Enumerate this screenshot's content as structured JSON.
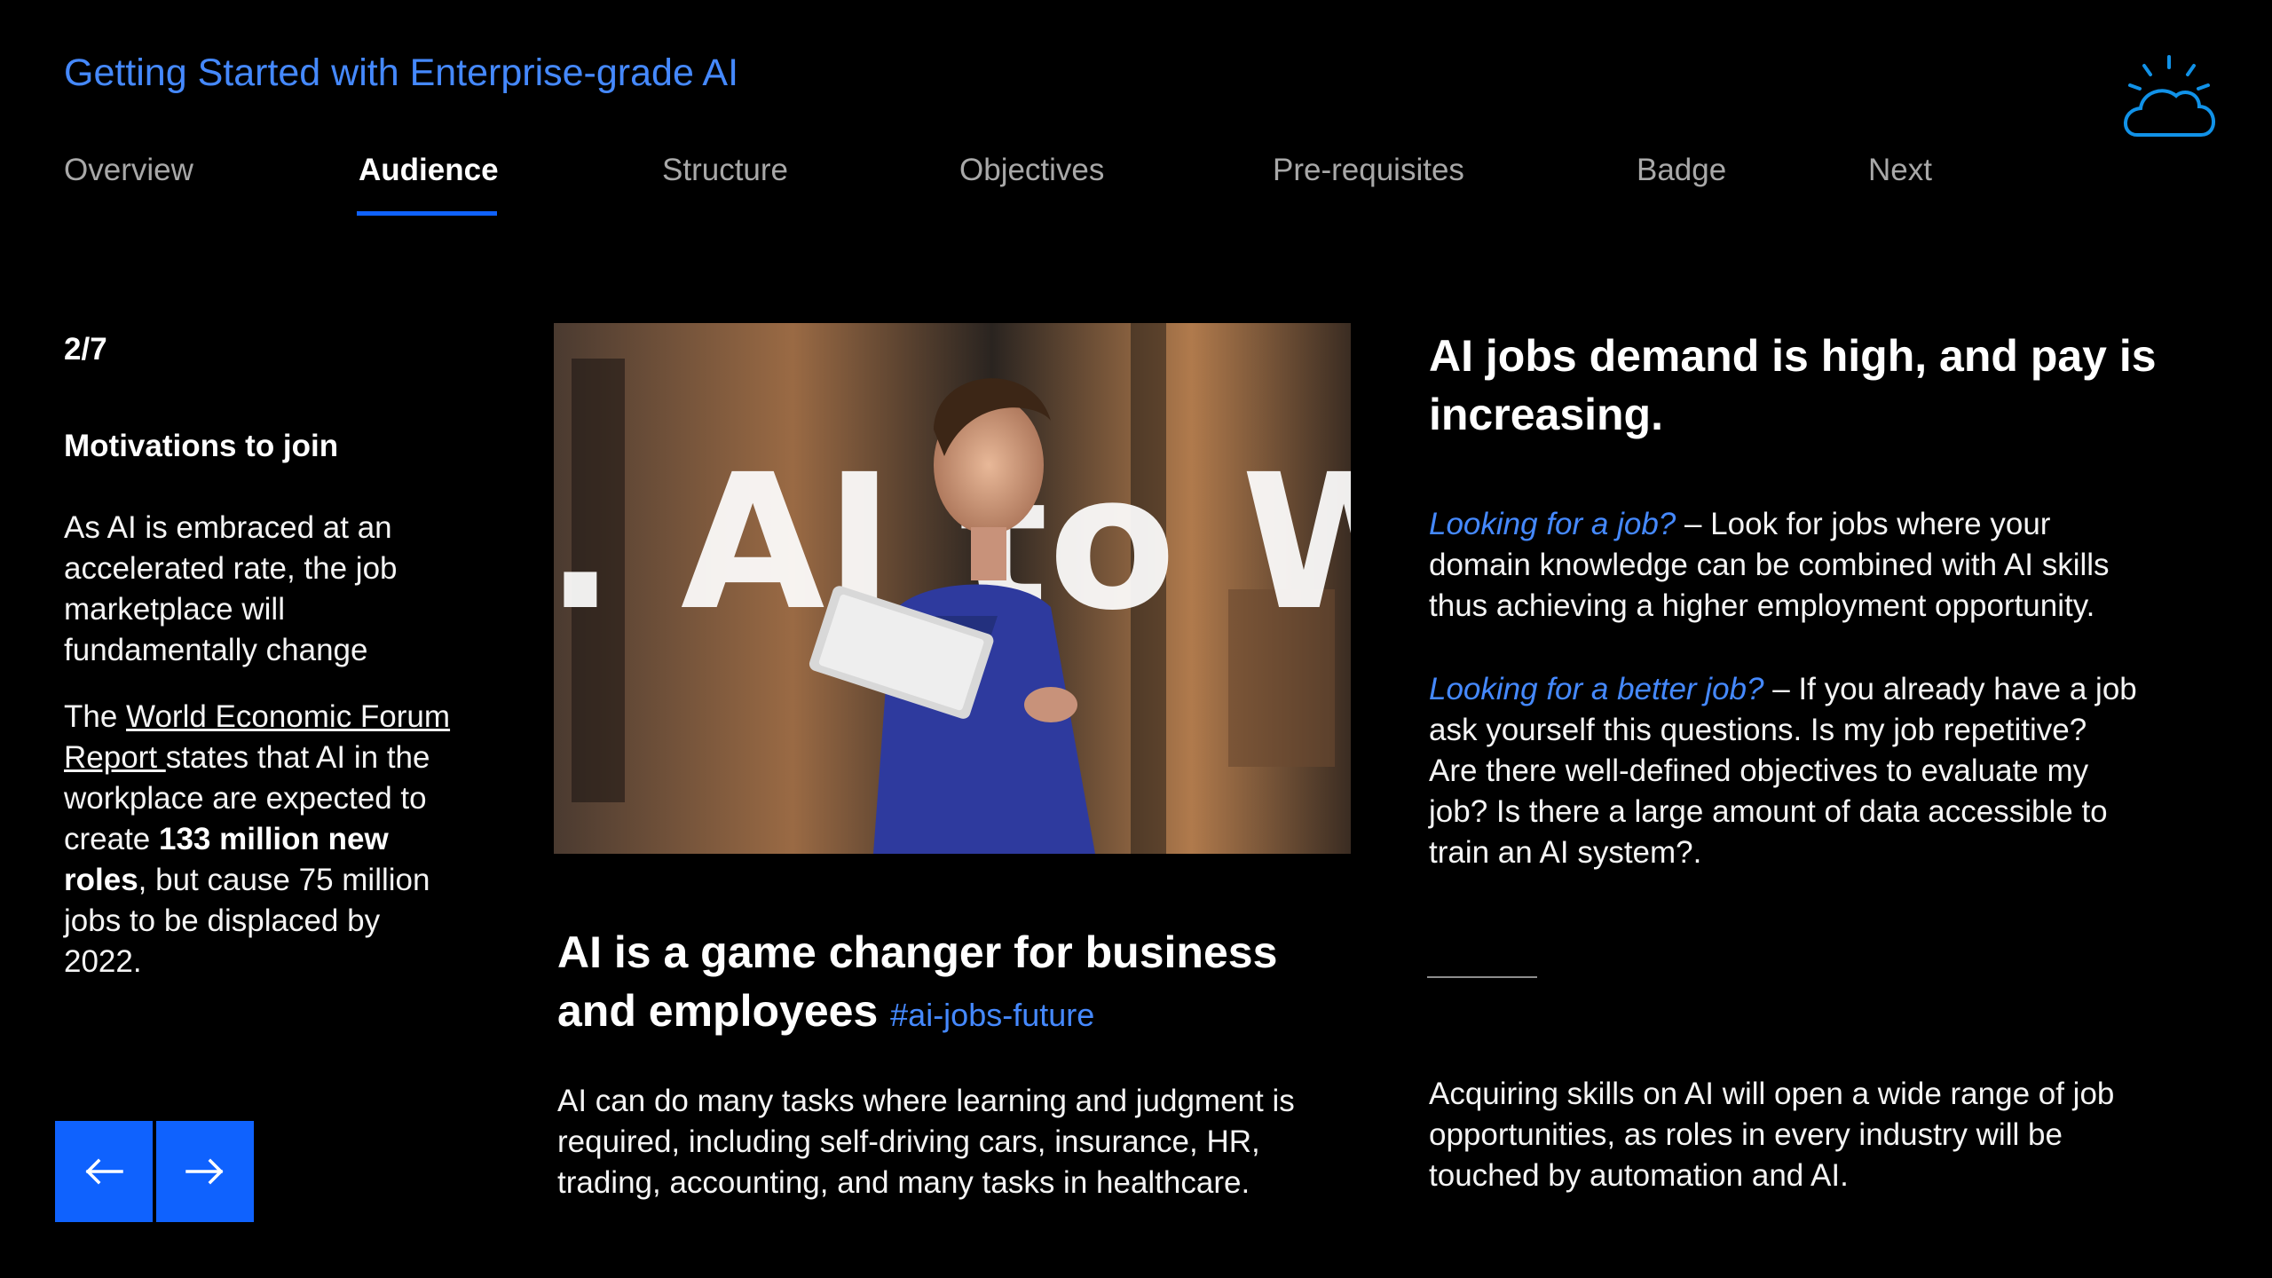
{
  "header": {
    "title": "Getting Started with Enterprise-grade AI",
    "logo_icon": "ibm-cloud-icon"
  },
  "tabs": [
    {
      "label": "Overview",
      "active": false
    },
    {
      "label": "Audience",
      "active": true
    },
    {
      "label": "Structure",
      "active": false
    },
    {
      "label": "Objectives",
      "active": false
    },
    {
      "label": "Pre-requisites",
      "active": false
    },
    {
      "label": "Badge",
      "active": false
    },
    {
      "label": "Next",
      "active": false
    }
  ],
  "left": {
    "progress": "2/7",
    "heading": "Motivations to join",
    "para1": "As AI is embraced at an accelerated rate, the job marketplace will fundamentally change",
    "para2": {
      "prefix": "The ",
      "link": "World Economic Forum Report ",
      "mid": "states that AI in the workplace are expected to create ",
      "bold": "133 million new roles",
      "suffix": ", but cause 75 million jobs to be displaced by 2022."
    },
    "prev_icon": "arrow-left-icon",
    "next_icon": "arrow-right-icon"
  },
  "center": {
    "image_text": ". AI to Wo",
    "heading": "AI is a game changer for business and employees ",
    "tag": "#ai-jobs-future",
    "body": "AI can do many tasks where learning and judgment is required, including self-driving cars, insurance, HR, trading, accounting, and many tasks in healthcare."
  },
  "right": {
    "heading": "AI jobs demand is high, and pay is increasing.",
    "job_lead": "Looking for a job?",
    "job_text": " – Look for jobs where your domain knowledge can be combined with AI skills thus achieving a higher employment opportunity.",
    "better_lead": "Looking for a better job?",
    "better_text": " – If you already have a job ask yourself this questions. Is my job repetitive? Are there well-defined objectives to evaluate my job? Is there a large amount of data accessible to train an AI system?.",
    "closing": "Acquiring skills on AI will open a wide range of job opportunities, as roles in every industry will be touched by automation and AI."
  },
  "colors": {
    "accent": "#0f62fe",
    "link": "#4589ff",
    "background": "#000000"
  }
}
